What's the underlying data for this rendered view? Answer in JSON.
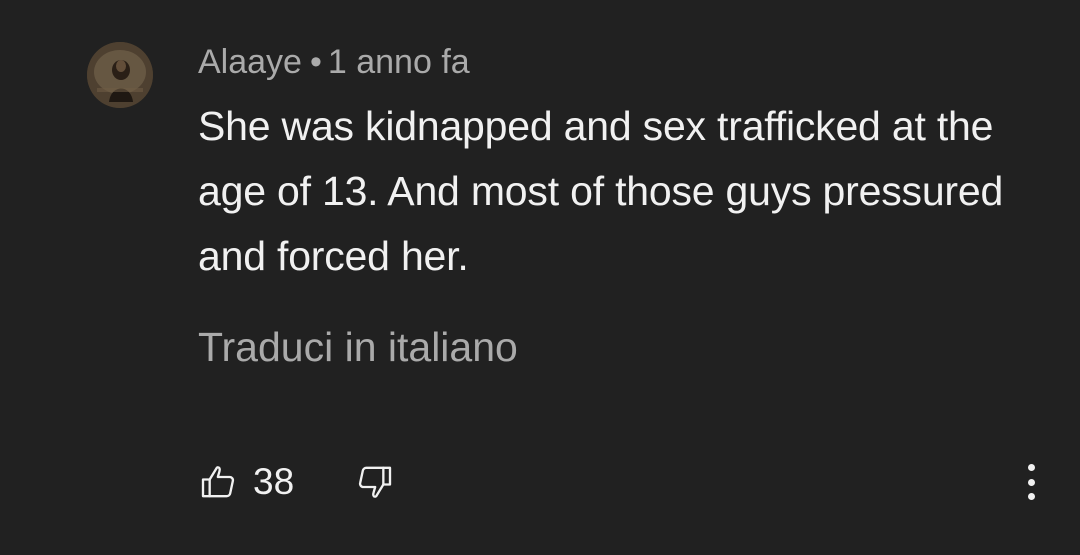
{
  "comment": {
    "author": "Alaaye",
    "separator": "•",
    "time": "1 anno fa",
    "text": "She was kidnapped and sex trafficked at the age of 13. And most of those guys pressured and forced her.",
    "translate_label": "Traduci in italiano",
    "like_count": "38"
  },
  "icons": {
    "like": "thumbs-up-icon",
    "dislike": "thumbs-down-icon",
    "more": "more-vertical-icon"
  },
  "colors": {
    "background": "#212121",
    "primary_text": "#f1f1f1",
    "secondary_text": "#aaaaaa"
  }
}
